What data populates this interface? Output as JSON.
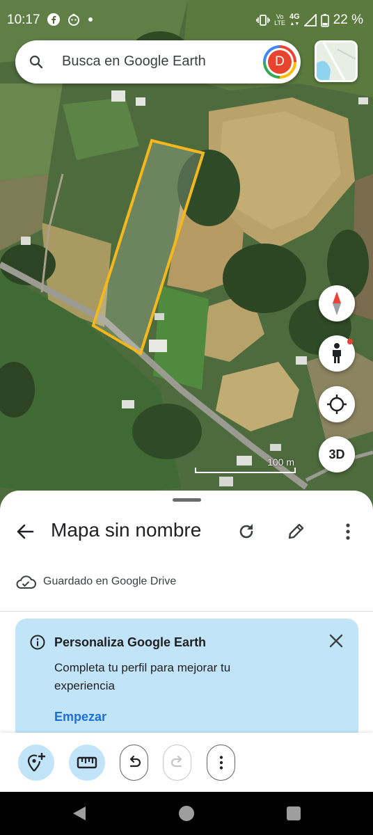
{
  "status_bar": {
    "time": "10:17",
    "network_top": "4G",
    "network_label_top": "Vo",
    "network_label_bottom": "LTE",
    "battery": "22 %",
    "icons": [
      "facebook-icon",
      "baby-face-icon",
      "dot-icon",
      "vibrate-icon",
      "signal-icon",
      "battery-icon"
    ]
  },
  "search": {
    "placeholder": "Busca en Google Earth",
    "avatar_initial": "D",
    "avatar_color": "#e8442d"
  },
  "map": {
    "scale_label": "100 m",
    "fab_3d_label": "3D",
    "polygon_color": "#f5b81c",
    "buttons": [
      "compass-button",
      "street-view-button",
      "my-location-button",
      "3d-button"
    ]
  },
  "sheet": {
    "title": "Mapa sin nombre",
    "saved_text": "Guardado en Google Drive",
    "card": {
      "title": "Personaliza Google Earth",
      "body": "Completa tu perfil para mejorar tu experiencia",
      "action": "Empezar",
      "background": "#c2e4f9",
      "action_color": "#1a6fd8"
    }
  },
  "toolbar": {
    "items": [
      "add-placemark",
      "measure",
      "undo",
      "redo",
      "more"
    ],
    "redo_enabled": false
  },
  "nav_bar": {
    "items": [
      "back",
      "home",
      "recents"
    ]
  }
}
